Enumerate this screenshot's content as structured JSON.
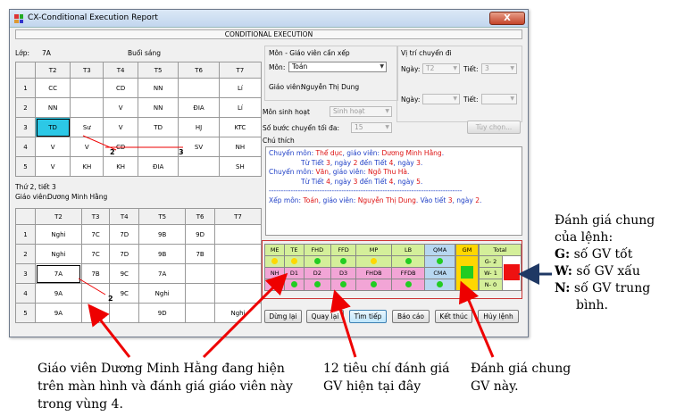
{
  "window": {
    "title": "CX-Conditional Execution Report",
    "close_glyph": "X",
    "header": "CONDITIONAL EXECUTION"
  },
  "top": {
    "class_label": "Lớp:",
    "class_value": "7A",
    "session": "Buổi sáng"
  },
  "days": [
    "T2",
    "T3",
    "T4",
    "T5",
    "T6",
    "T7"
  ],
  "grid1": {
    "rows": [
      {
        "n": "1",
        "c": [
          "CC",
          "",
          "CD",
          "NN",
          "",
          "Lí"
        ]
      },
      {
        "n": "2",
        "c": [
          "NN",
          "",
          "V",
          "NN",
          "ĐIA",
          "Lí"
        ]
      },
      {
        "n": "3",
        "c": [
          "TD",
          "Sư",
          "V",
          "TD",
          "HJ",
          "KTC"
        ]
      },
      {
        "n": "4",
        "c": [
          "V",
          "V",
          "CD",
          "",
          "SV",
          "NH"
        ]
      },
      {
        "n": "5",
        "c": [
          "V",
          "KH",
          "KH",
          "ĐIA",
          "",
          "SH"
        ]
      }
    ]
  },
  "grid1_marks": {
    "m2": "2",
    "m3": "3"
  },
  "info": {
    "day_period": "Thứ 2, tiết 3",
    "teacher_label": "Giáo viên:",
    "teacher_name": "Dương Minh Hằng"
  },
  "grid2": {
    "rows": [
      {
        "n": "1",
        "c": [
          "Nghi",
          "7C",
          "7D",
          "9B",
          "9D",
          ""
        ]
      },
      {
        "n": "2",
        "c": [
          "Nghi",
          "7C",
          "7D",
          "9B",
          "7B",
          ""
        ]
      },
      {
        "n": "3",
        "c": [
          "7A",
          "7B",
          "9C",
          "7A",
          "",
          ""
        ]
      },
      {
        "n": "4",
        "c": [
          "9A",
          "",
          "9C",
          "Nghi",
          "",
          ""
        ]
      },
      {
        "n": "5",
        "c": [
          "9A",
          "",
          "",
          "9D",
          "",
          "Nghi"
        ]
      }
    ]
  },
  "grid2_marks": {
    "m2": "2"
  },
  "form": {
    "subject_group": "Môn - Giáo viên cần xếp",
    "subject_label": "Môn:",
    "subject_value": "Toán",
    "teacher_label": "Giáo viên:",
    "teacher_value": "Nguyễn Thị Dung",
    "pos_group": "Vị trí chuyển đi",
    "day_label": "Ngày:",
    "day_value": "T2",
    "period_label": "Tiết:",
    "period_value": "3",
    "day2_label": "Ngày:",
    "day2_value": "",
    "period2_label": "Tiết:",
    "period2_value": "",
    "activity_label": "Môn sinh hoạt",
    "activity_value": "Sinh hoạt",
    "steps_label": "Số bước chuyển tối đa:",
    "steps_value": "15",
    "options_button": "Tùy chọn...",
    "notes_label": "Chú thích"
  },
  "notes": [
    {
      "a": "Chuyển môn: ",
      "b": "Thể dục",
      "c": ", giáo viên: ",
      "d": "Dương Minh Hằng",
      "e": "."
    },
    {
      "a": "Từ Tiết ",
      "b": "3",
      "c": ", ngày ",
      "d": "2",
      "e": " đến Tiết ",
      "f": "4",
      "g": ", ngày ",
      "h": "3",
      "i": "."
    },
    {
      "a": "Chuyển môn: ",
      "b": "Văn",
      "c": ", giáo viên: ",
      "d": "Ngô Thu Hà",
      "e": "."
    },
    {
      "a": "Từ Tiết ",
      "b": "4",
      "c": ", ngày ",
      "d": "3",
      "e": " đến Tiết ",
      "f": "4",
      "g": ", ngày ",
      "h": "5",
      "i": "."
    },
    {
      "sep": "--------------------------------------------------------------------------------"
    },
    {
      "a": "Xếp môn: ",
      "b": "Toán",
      "c": ", giáo viên: ",
      "d": "Nguyễn Thị Dung",
      "e": ". Vào tiết ",
      "f": "3",
      "g": ", ngày ",
      "h": "2",
      "i": "."
    }
  ],
  "criteria": {
    "top": [
      "ME",
      "TE",
      "FHD",
      "FFD",
      "MP",
      "LB",
      "QMA"
    ],
    "bottom": [
      "NH",
      "D1",
      "D2",
      "D3",
      "FHDB",
      "FFDB",
      "CMA"
    ],
    "gm": "GM",
    "total": "Total",
    "g": "G- 2",
    "w": "W- 1",
    "n": "N- 0",
    "top_dots": [
      "#ffd700",
      "#ffd700",
      "#22cc22",
      "#22cc22",
      "#ffd700",
      "#22cc22",
      "#22cc22"
    ],
    "bottom_dots": [
      "#22cc22",
      "#22cc22",
      "#22cc22",
      "#22cc22",
      "#22cc22",
      "#22cc22",
      "#22cc22"
    ],
    "colors": {
      "pink": "#f2a5d6",
      "green": "#22cc22",
      "red": "#ee1111",
      "lblue": "#b7d7f0",
      "ygreen": "#d4ef9a"
    }
  },
  "buttons": {
    "stop": "Dừng lại",
    "back": "Quay lại",
    "next": "Tìm tiếp",
    "report": "Báo cáo",
    "end": "Kết thúc",
    "cancel": "Hủy lệnh"
  },
  "annotations": {
    "general": [
      "Đánh giá chung",
      "của lệnh:"
    ],
    "g_key": "G:",
    "g_text": " số GV tốt",
    "w_key": "W:",
    "w_text": " số GV xấu",
    "n_key": "N:",
    "n_text": " số GV trung",
    "n_text2": "bình.",
    "teacher_note": [
      "Giáo viên Dương Minh Hằng đang hiện",
      "trên màn hình và đánh giá giáo viên này",
      "trong vùng 4."
    ],
    "criteria_note": [
      "12 tiêu chí đánh giá",
      "GV hiện tại đây"
    ],
    "gv_note": [
      "Đánh giá chung",
      "GV này."
    ]
  }
}
